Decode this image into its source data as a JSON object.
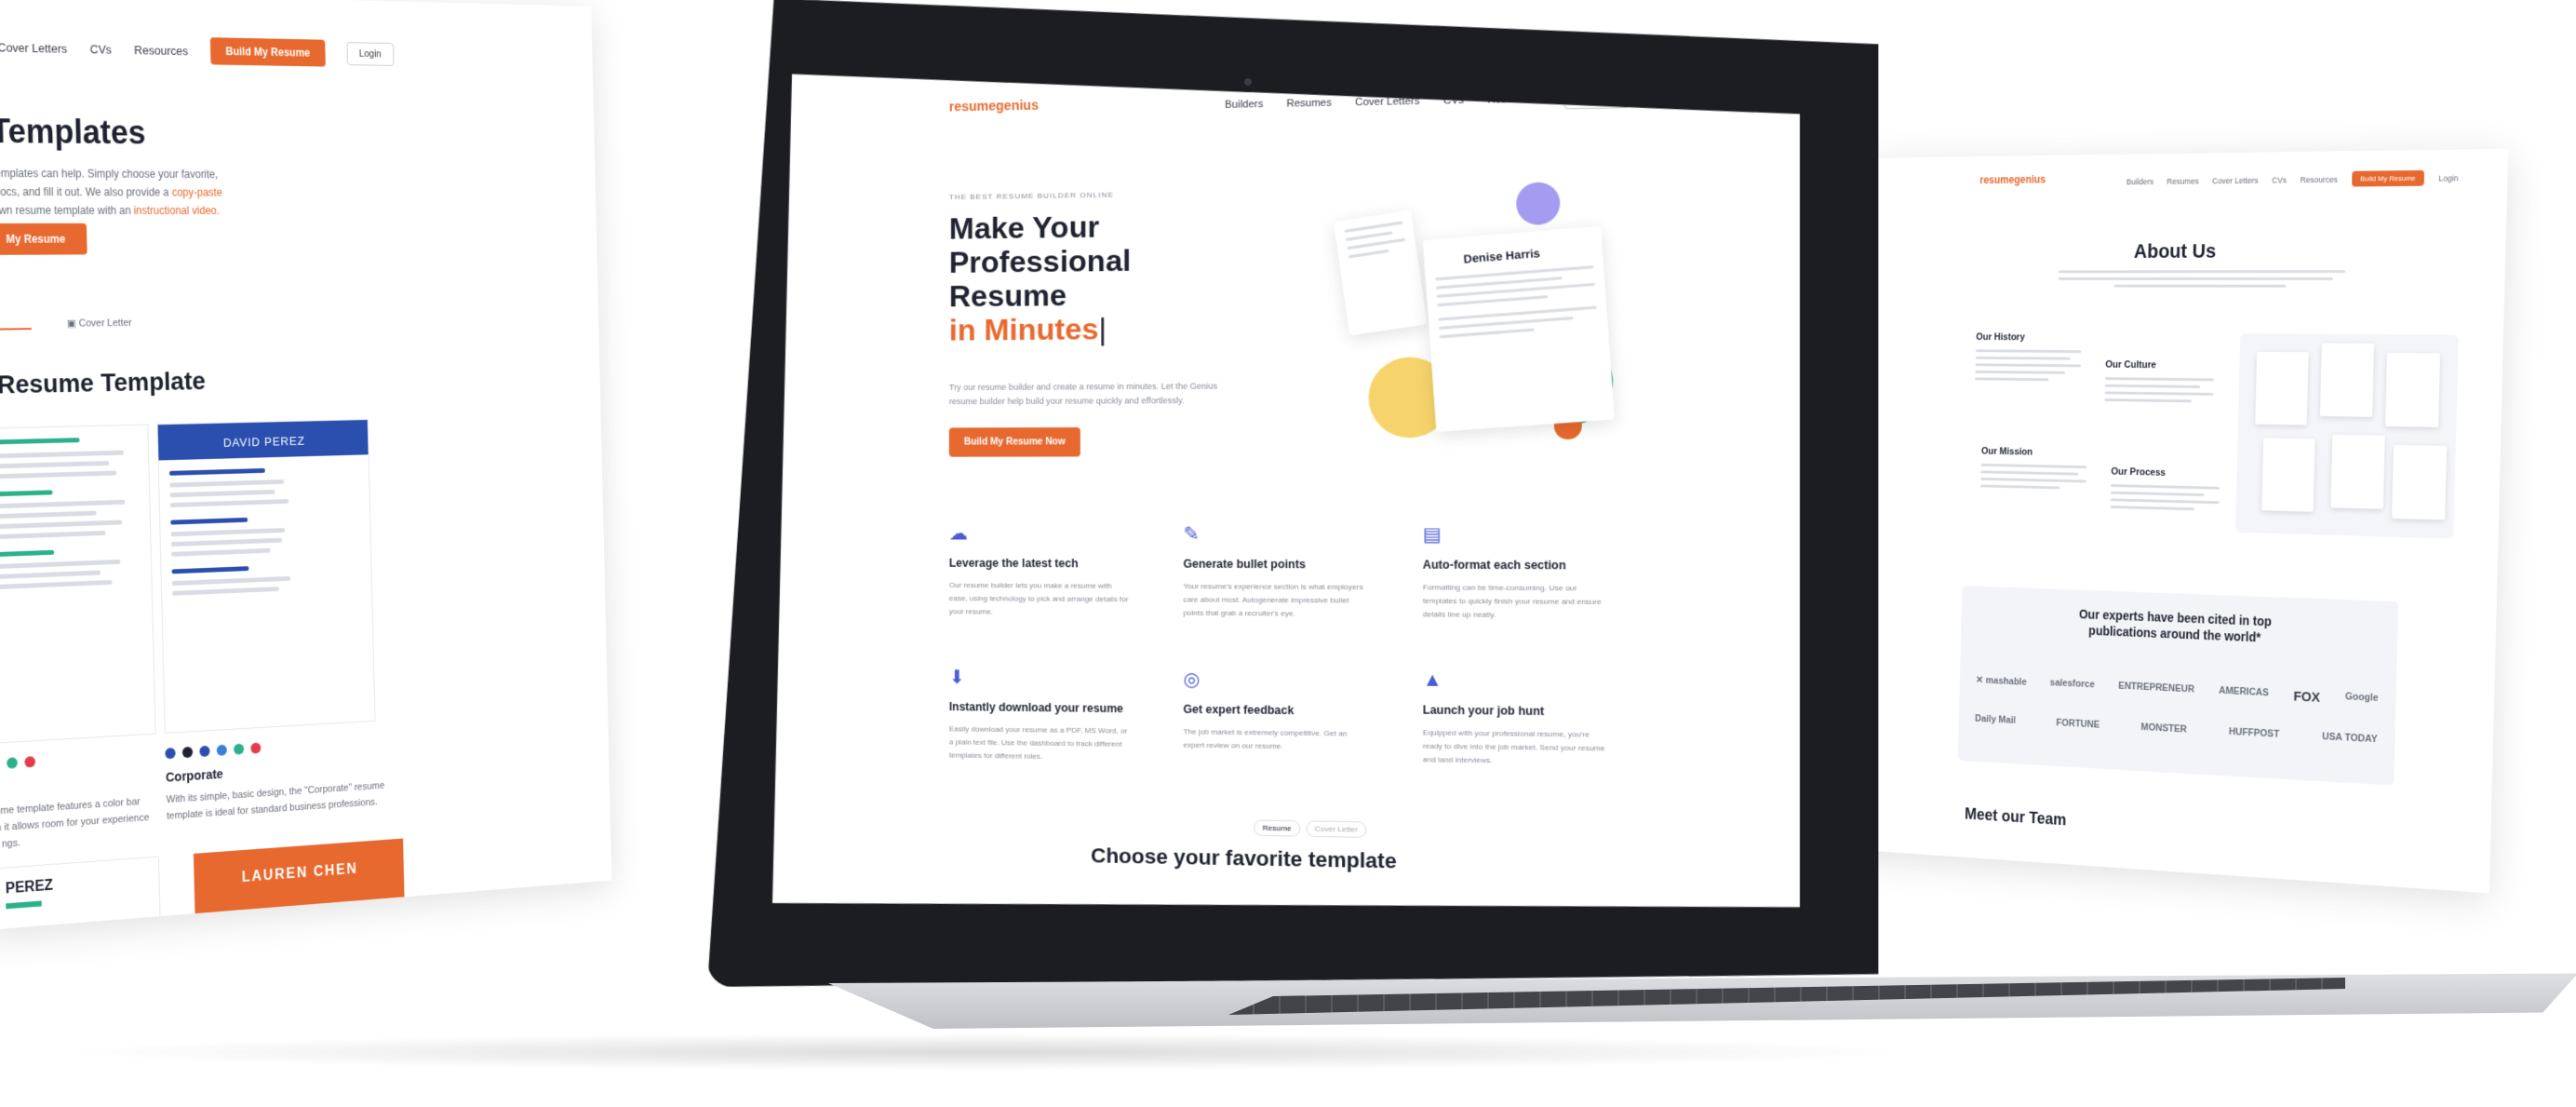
{
  "colors": {
    "accent": "#e8692f",
    "brand_blue": "#2a4fae",
    "green": "#2bb28a",
    "yellow": "#f7d46b"
  },
  "left_panel": {
    "nav": [
      "Cover Letters",
      "CVs",
      "Resources"
    ],
    "nav_cta": "Build My Resume",
    "login": "Login",
    "title": "Templates",
    "intro_line1": "templates can help. Simply choose your favorite,",
    "intro_line2": "Docs, and fill it out. We also provide a",
    "intro_link": "copy-paste",
    "intro_line3": "own resume template with an",
    "intro_link2": "instructional video.",
    "cta": "My Resume",
    "tab_cover_letter": "Cover Letter",
    "section_title": "Resume Template",
    "tpl2_name": "DAVID PEREZ",
    "template_name": "Corporate",
    "template_desc": "With its simple, basic design, the \"Corporate\" resume template is ideal for standard business professions.",
    "left_desc": "sume template features a color bar on it allows room for your experience to ngs.",
    "card_perez": "PEREZ",
    "card_chen": "LAUREN CHEN",
    "swatches": [
      "#2a4fae",
      "#1f2330",
      "#2a4fae",
      "#3b7fd9",
      "#2bb28a",
      "#e23d4a"
    ],
    "swatches_left": [
      "#2bb28a",
      "#2bb28a",
      "#e23d4a"
    ]
  },
  "laptop_screen": {
    "logo": "resumegenius",
    "nav": [
      "Builders",
      "Resumes",
      "Cover Letters",
      "CVs",
      "Resources"
    ],
    "login": "Login",
    "eyebrow": "THE BEST RESUME BUILDER ONLINE",
    "headline_l1": "Make Your",
    "headline_l2": "Professional",
    "headline_l3": "Resume",
    "headline_l4": "in Minutes",
    "lede": "Try our resume builder and create a resume in minutes. Let the Genius resume builder help build your resume quickly and effortlessly.",
    "hero_cta": "Build My Resume Now",
    "hero_name": "Denise Harris",
    "features": [
      {
        "icon": "☁",
        "title": "Leverage the latest tech",
        "text": "Our resume builder lets you make a resume with ease, using technology to pick and arrange details for your resume."
      },
      {
        "icon": "✎",
        "title": "Generate bullet points",
        "text": "Your resume's experience section is what employers care about most. Autogenerate impressive bullet points that grab a recruiter's eye."
      },
      {
        "icon": "▤",
        "title": "Auto-format each section",
        "text": "Formatting can be time-consuming. Use our templates to quickly finish your resume and ensure details line up neatly."
      },
      {
        "icon": "⬇",
        "title": "Instantly download your resume",
        "text": "Easily download your resume as a PDF, MS Word, or a plain text file. Use the dashboard to track different templates for different roles."
      },
      {
        "icon": "◎",
        "title": "Get expert feedback",
        "text": "The job market is extremely competitive. Get an expert review on our resume."
      },
      {
        "icon": "▲",
        "title": "Launch your job hunt",
        "text": "Equipped with your professional resume, you're ready to dive into the job market. Send your resume and land interviews."
      }
    ],
    "toggle": [
      "Resume",
      "Cover Letter"
    ],
    "section_title": "Choose your favorite template"
  },
  "right_panel": {
    "logo": "resumegenius",
    "nav": [
      "Builders",
      "Resumes",
      "Cover Letters",
      "CVs",
      "Resources"
    ],
    "nav_cta": "Build My Resume",
    "login": "Login",
    "title": "About Us",
    "history": "Our History",
    "culture": "Our Culture",
    "mission": "Our Mission",
    "process": "Our Process",
    "cited_l1": "Our experts have been cited in top",
    "cited_l2": "publications around the world*",
    "logos_row1": [
      "✕ mashable",
      "salesforce",
      "ENTREPRENEUR",
      "AMERICAS",
      "FOX",
      "Google"
    ],
    "logos_row2": [
      "Daily Mail",
      "FORTUNE",
      "MONSTER",
      "HUFFPOST",
      "USA TODAY"
    ],
    "team_title": "Meet our Team"
  }
}
